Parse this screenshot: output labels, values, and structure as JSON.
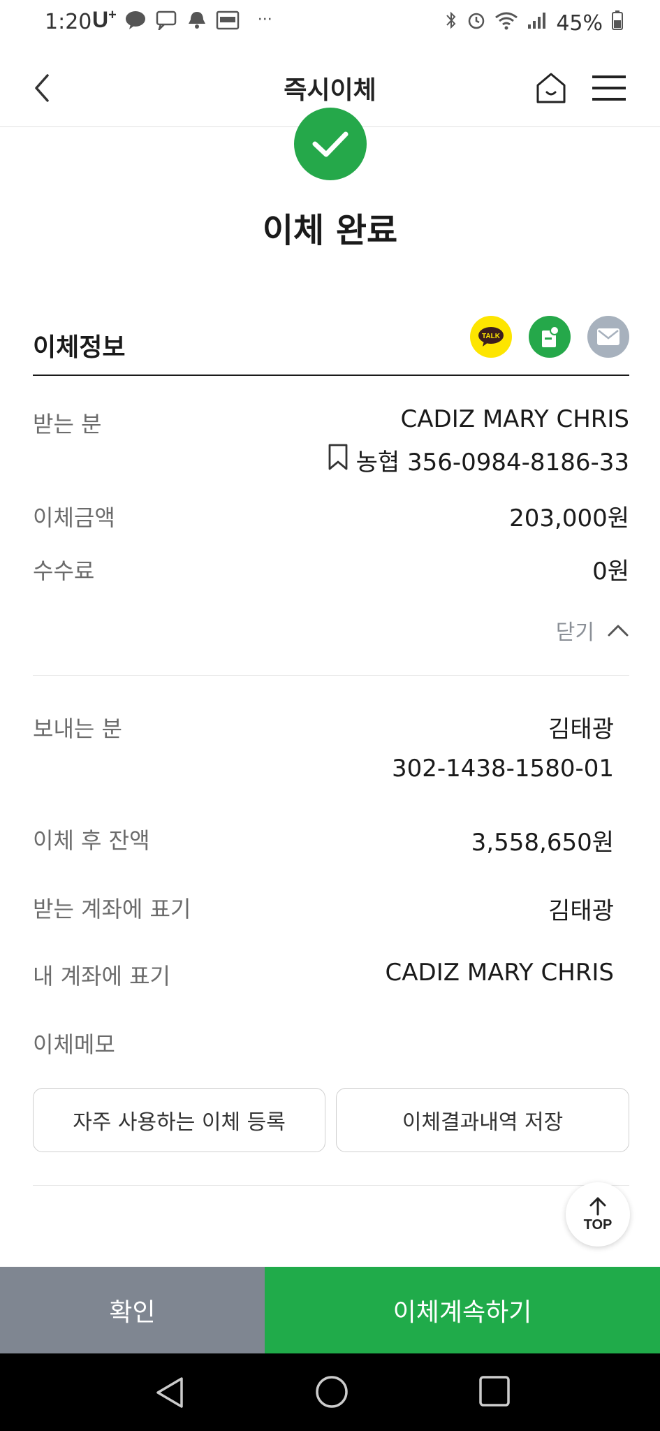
{
  "status_bar": {
    "time": "1:20",
    "carrier": "U",
    "carrier_sup": "+",
    "battery": "45%",
    "more": "···"
  },
  "header": {
    "title": "즉시이체"
  },
  "result": {
    "title": "이체 완료"
  },
  "section": {
    "title": "이체정보",
    "share_talk_label": "TALK"
  },
  "transfer": {
    "recipient_label": "받는 분",
    "recipient_name": "CADIZ MARY CHRIS",
    "recipient_bank_account": "농협 356-0984-8186-33",
    "amount_label": "이체금액",
    "amount": "203,000원",
    "fee_label": "수수료",
    "fee": "0원",
    "toggle_label": "닫기"
  },
  "details": {
    "sender_label": "보내는 분",
    "sender_name": "김태광",
    "sender_account": "302-1438-1580-01",
    "balance_label": "이체 후 잔액",
    "balance": "3,558,650원",
    "recipient_display_label": "받는 계좌에 표기",
    "recipient_display": "김태광",
    "my_display_label": "내 계좌에 표기",
    "my_display": "CADIZ MARY CHRIS",
    "memo_label": "이체메모"
  },
  "actions": {
    "register_favorite": "자주 사용하는 이체 등록",
    "save_result": "이체결과내역 저장",
    "top_label": "TOP"
  },
  "bottom_bar": {
    "confirm": "확인",
    "continue": "이체계속하기"
  },
  "colors": {
    "brand_green": "#25a84a",
    "confirm_gray": "#7f8691",
    "kakao_yellow": "#fde500"
  }
}
